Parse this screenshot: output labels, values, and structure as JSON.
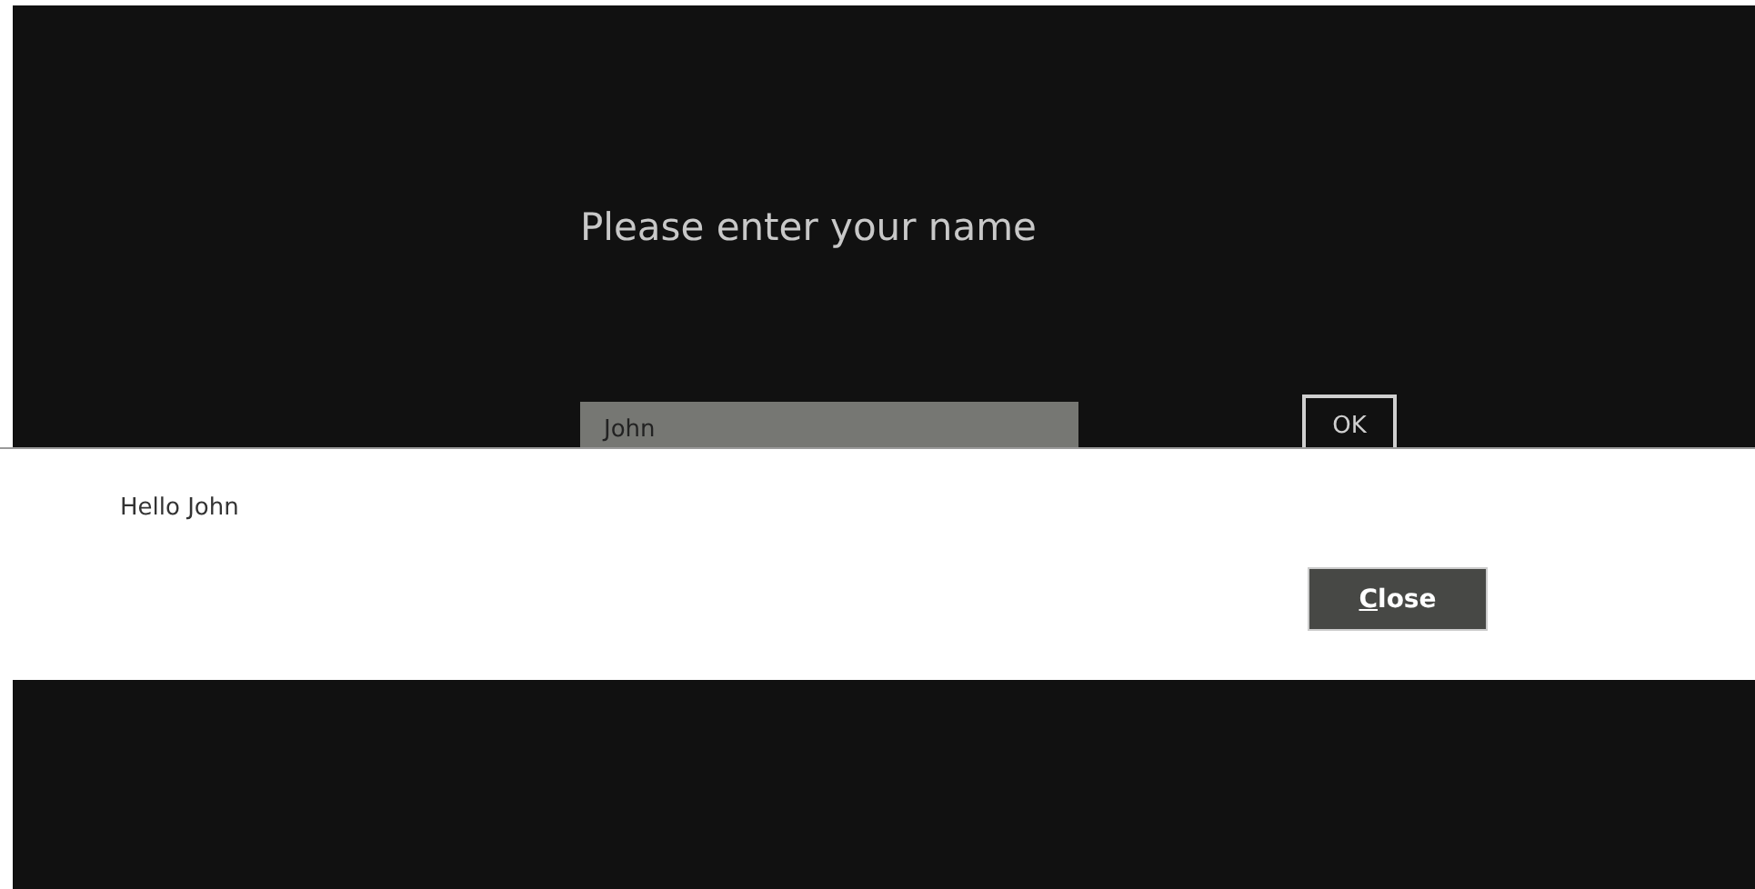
{
  "page": {
    "prompt": "Please enter your name",
    "name_field": {
      "value": "John"
    },
    "ok_button": {
      "label": "OK"
    }
  },
  "dialog": {
    "message": "Hello John",
    "close_button": {
      "label": "Close",
      "access_key_underlined": true
    }
  }
}
